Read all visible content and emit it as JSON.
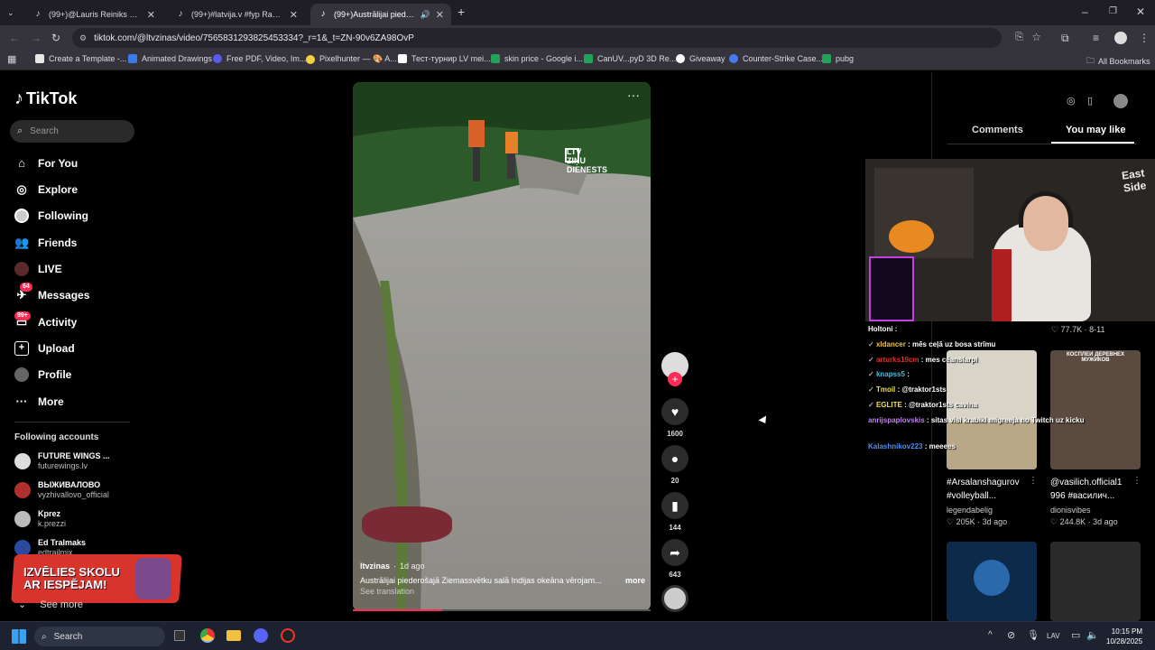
{
  "browser": {
    "tabs": [
      {
        "title": "(99+)@Lauris Reiniks #tommyc",
        "active": false
      },
      {
        "title": "(99+)#latvija.v #fyp Rakstiet ko",
        "active": false
      },
      {
        "title": "(99+)Austrālijai piederošajā",
        "active": true
      }
    ],
    "url": "tiktok.com/@ltvzinas/video/7565831293825453334?_r=1&_t=ZN-90v6ZA98OvP",
    "bookmarks": [
      {
        "label": "Create a Template -...",
        "color": "#e8e8e8"
      },
      {
        "label": "Animated Drawings",
        "color": "#3b7be8"
      },
      {
        "label": "Free PDF, Video, Im...",
        "color": "#5a5af0"
      },
      {
        "label": "Pixelhunter — 🎨 A...",
        "color": "#f5d040"
      },
      {
        "label": "Тест-турнир LV mei...",
        "color": "#ffffff"
      },
      {
        "label": "skin price - Google i...",
        "color": "#21a35a"
      },
      {
        "label": "CanUV...pyD 3D Re...",
        "color": "#21a35a"
      },
      {
        "label": "Giveaway",
        "color": "#ffffff"
      },
      {
        "label": "Counter-Strike Case...",
        "color": "#4a7af0"
      },
      {
        "label": "pubg",
        "color": "#21a35a"
      }
    ],
    "all_bookmarks": "All Bookmarks"
  },
  "sidebar": {
    "logo": "TikTok",
    "search_placeholder": "Search",
    "nav": [
      {
        "label": "For You",
        "icon": "home-icon"
      },
      {
        "label": "Explore",
        "icon": "compass-icon"
      },
      {
        "label": "Following",
        "icon": "following-icon"
      },
      {
        "label": "Friends",
        "icon": "friends-icon"
      },
      {
        "label": "LIVE",
        "icon": "live-icon"
      },
      {
        "label": "Messages",
        "icon": "messages-icon",
        "badge": "64"
      },
      {
        "label": "Activity",
        "icon": "activity-icon",
        "badge": "99+"
      },
      {
        "label": "Upload",
        "icon": "upload-icon"
      },
      {
        "label": "Profile",
        "icon": "profile-icon"
      },
      {
        "label": "More",
        "icon": "more-icon"
      }
    ],
    "following_title": "Following accounts",
    "following": [
      {
        "name": "FUTURE WINGS ...",
        "user": "futurewings.lv"
      },
      {
        "name": "ВЫЖИВАЛОВО",
        "user": "vyzhivallovo_official"
      },
      {
        "name": "Kprez",
        "user": "k.prezzi"
      },
      {
        "name": "Ed Tralmaks",
        "user": "edtrailmix"
      }
    ],
    "see_more": "See more",
    "promo": [
      "IZVĒLIES SKOLU",
      "AR IESPĒJAM!"
    ]
  },
  "video": {
    "watermark": [
      "LTV",
      "ZIŅU",
      "DIENESTS"
    ],
    "author": "ltvzinas",
    "age": "1d ago",
    "caption": "Austrālijai piederošajā Ziemassvētku salā Indijas okeāna vērojam...",
    "more": "more",
    "see_translation": "See translation",
    "progress": 0.3
  },
  "actions": {
    "likes": "1600",
    "comments": "20",
    "saves": "144",
    "shares": "643"
  },
  "right_panel": {
    "tabs": [
      "Comments",
      "You may like"
    ],
    "cards": [
      {
        "likes": "77.7K",
        "age": "8-11"
      },
      {
        "caption": "#Arsalanshagurov #volleyball...",
        "user": "legendabelig",
        "likes": "205K",
        "age": "3d ago"
      },
      {
        "caption": "@vasilich.official1 996 #василич...",
        "user": "dionisvibes",
        "likes": "244.8K",
        "age": "3d ago",
        "thumb_text": "КОСПЛЕИ ДЕРЕВНЕХ МУЖИКОВ"
      }
    ]
  },
  "stream_overlay": {
    "chat": [
      {
        "user": "Holtoni",
        "msg": ":",
        "color": "#ffffff"
      },
      {
        "user": "xldancer",
        "msg": ": mēs ceļā uz bosa strīmu",
        "color": "#f0c040"
      },
      {
        "user": "arturks19cm",
        "msg": ": mes cēanslarpi",
        "color": "#e03030"
      },
      {
        "user": "knapss5",
        "msg": ":",
        "color": "#40c0e0"
      },
      {
        "user": "Tmoil",
        "msg": ": @traktor1sts",
        "color": "#f0e040"
      },
      {
        "user": "EGLITE",
        "msg": ": @traktor1sts cavina",
        "color": "#f0e040"
      },
      {
        "user": "anrijspaplovskis",
        "msg": ": sitas visi krabiki migreeja no Twitch uz kicku",
        "color": "#c080f0"
      },
      {
        "user": "Kalashnikov223",
        "msg": ": meeees",
        "color": "#5090f0"
      }
    ],
    "wall_text": [
      "East",
      "Side"
    ]
  },
  "taskbar": {
    "search": "Search",
    "lang": "LAV",
    "time": "10:15 PM",
    "date": "10/28/2025"
  }
}
